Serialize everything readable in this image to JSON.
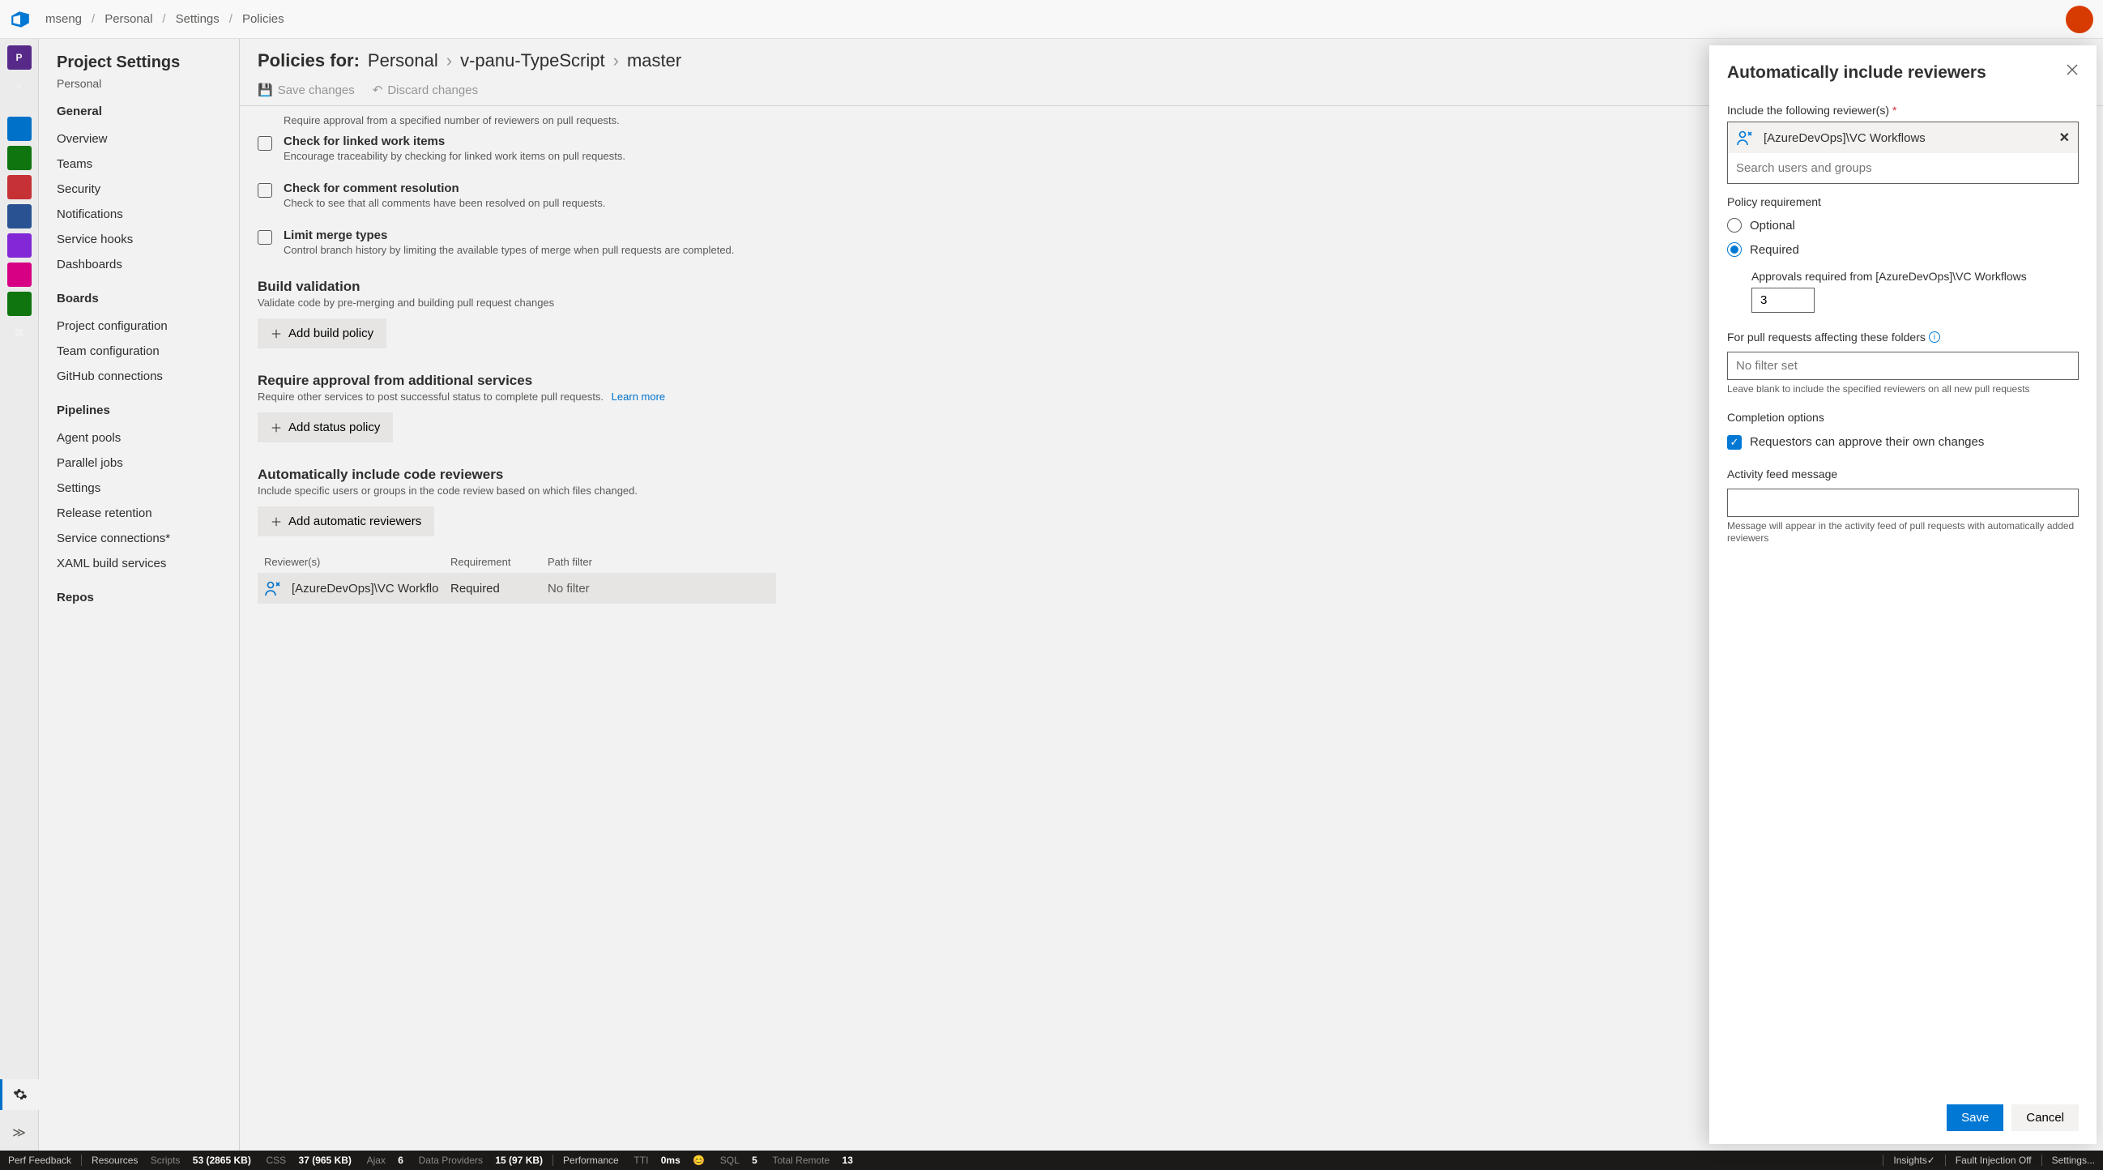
{
  "breadcrumb": {
    "org": "mseng",
    "project": "Personal",
    "section": "Settings",
    "page": "Policies"
  },
  "avatar_color": "#d83b01",
  "sidepanel": {
    "title": "Project Settings",
    "subtitle": "Personal",
    "sections": {
      "general_label": "General",
      "general_items": [
        "Overview",
        "Teams",
        "Security",
        "Notifications",
        "Service hooks",
        "Dashboards"
      ],
      "boards_label": "Boards",
      "boards_items": [
        "Project configuration",
        "Team configuration",
        "GitHub connections"
      ],
      "pipelines_label": "Pipelines",
      "pipelines_items": [
        "Agent pools",
        "Parallel jobs",
        "Settings",
        "Release retention",
        "Service connections*",
        "XAML build services"
      ],
      "repos_label": "Repos"
    }
  },
  "header": {
    "policies_for_label": "Policies for:",
    "crumb1": "Personal",
    "crumb2": "v-panu-TypeScript",
    "crumb3": "master",
    "save_label": "Save changes",
    "discard_label": "Discard changes"
  },
  "policies": {
    "truncated_desc": "Require approval from a specified number of reviewers on pull requests.",
    "linked": {
      "title": "Check for linked work items",
      "desc": "Encourage traceability by checking for linked work items on pull requests."
    },
    "comment": {
      "title": "Check for comment resolution",
      "desc": "Check to see that all comments have been resolved on pull requests."
    },
    "merge": {
      "title": "Limit merge types",
      "desc": "Control branch history by limiting the available types of merge when pull requests are completed."
    },
    "build": {
      "title": "Build validation",
      "desc": "Validate code by pre-merging and building pull request changes",
      "add_label": "Add build policy"
    },
    "status": {
      "title": "Require approval from additional services",
      "desc": "Require other services to post successful status to complete pull requests.",
      "learn_more": "Learn more",
      "add_label": "Add status policy"
    },
    "auto": {
      "title": "Automatically include code reviewers",
      "desc": "Include specific users or groups in the code review based on which files changed.",
      "add_label": "Add automatic reviewers"
    },
    "table": {
      "col1": "Reviewer(s)",
      "col2": "Requirement",
      "col3": "Path filter",
      "row": {
        "name": "[AzureDevOps]\\VC Workflo",
        "req": "Required",
        "filter": "No filter"
      }
    }
  },
  "flyout": {
    "title": "Automatically include reviewers",
    "reviewers_label": "Include the following reviewer(s)",
    "selected_reviewer": "[AzureDevOps]\\VC Workflows",
    "search_placeholder": "Search users and groups",
    "policy_req_label": "Policy requirement",
    "optional_label": "Optional",
    "required_label": "Required",
    "approvals_label": "Approvals required from [AzureDevOps]\\VC Workflows",
    "approvals_value": "3",
    "folders_label": "For pull requests affecting these folders",
    "folders_placeholder": "No filter set",
    "folders_helper": "Leave blank to include the specified reviewers on all new pull requests",
    "completion_label": "Completion options",
    "requestors_label": "Requestors can approve their own changes",
    "activity_label": "Activity feed message",
    "activity_helper": "Message will appear in the activity feed of pull requests with automatically added reviewers",
    "save_label": "Save",
    "cancel_label": "Cancel"
  },
  "statusbar": {
    "perf": "Perf Feedback",
    "resources": "Resources",
    "scripts_label": "Scripts",
    "scripts_val": "53 (2865 KB)",
    "css_label": "CSS",
    "css_val": "37 (965 KB)",
    "ajax_label": "Ajax",
    "ajax_val": "6",
    "dp_label": "Data Providers",
    "dp_val": "15 (97 KB)",
    "performance": "Performance",
    "tti_label": "TTI",
    "tti_val": "0ms",
    "sql_label": "SQL",
    "sql_val": "5",
    "remote_label": "Total Remote",
    "remote_val": "13",
    "insights": "Insights✓",
    "fault": "Fault Injection Off",
    "settings": "Settings..."
  }
}
